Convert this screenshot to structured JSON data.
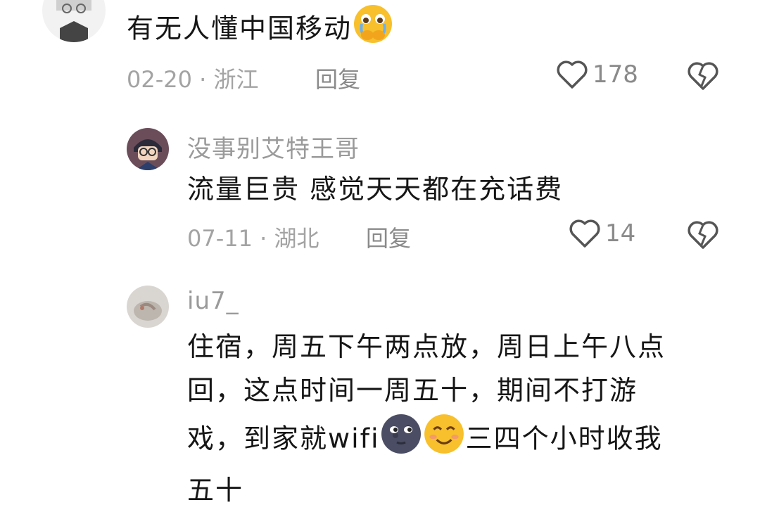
{
  "comments": [
    {
      "text": "有无人懂中国移动",
      "emoji": "cry-face-icon",
      "date": "02-20",
      "location": "浙江",
      "reply_label": "回复",
      "likes": "178"
    },
    {
      "username": "没事别艾特王哥",
      "text": "流量巨贵 感觉天天都在充话费",
      "date": "07-11",
      "location": "湖北",
      "reply_label": "回复",
      "likes": "14"
    },
    {
      "username": "iu7_",
      "text_line1": "住宿，周五下午两点放，周日上午八点",
      "text_line2": "回，这点时间一周五十，期间不打游",
      "text_line3a": "戏，到家就wifi",
      "text_line3b": "三四个小时收我",
      "text_line4": "五十",
      "emojis": [
        "moon-face-icon",
        "smile-face-icon"
      ]
    }
  ],
  "separator": " · ",
  "colors": {
    "text": "#161616",
    "meta": "#a3a3a3",
    "username": "#9a9a9a"
  }
}
